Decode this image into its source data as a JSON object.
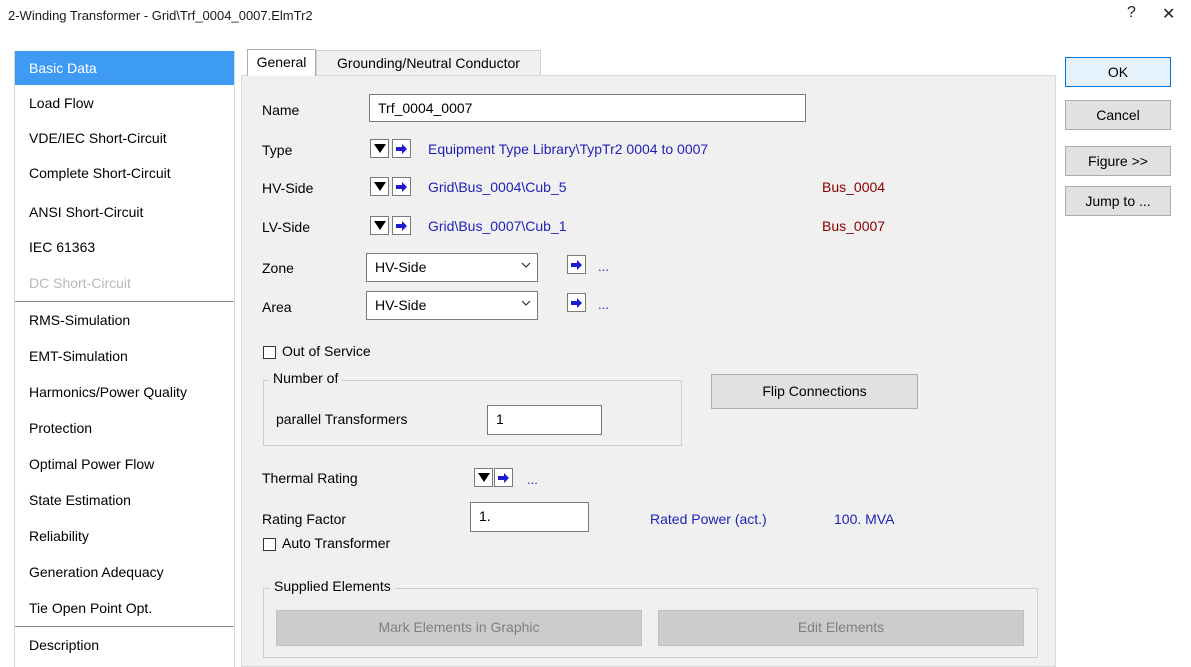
{
  "window": {
    "title": "2-Winding Transformer - Grid\\Trf_0004_0007.ElmTr2",
    "help_glyph": "?",
    "close_glyph": "✕"
  },
  "nav": {
    "items": [
      {
        "label": "Basic Data"
      },
      {
        "label": "Load Flow"
      },
      {
        "label": "VDE/IEC Short-Circuit"
      },
      {
        "label": "Complete Short-Circuit"
      },
      {
        "label": "ANSI Short-Circuit"
      },
      {
        "label": "IEC 61363"
      },
      {
        "label": "DC Short-Circuit"
      },
      {
        "label": "RMS-Simulation"
      },
      {
        "label": "EMT-Simulation"
      },
      {
        "label": "Harmonics/Power Quality"
      },
      {
        "label": "Protection"
      },
      {
        "label": "Optimal Power Flow"
      },
      {
        "label": "State Estimation"
      },
      {
        "label": "Reliability"
      },
      {
        "label": "Generation Adequacy"
      },
      {
        "label": "Tie Open Point Opt."
      },
      {
        "label": "Description"
      }
    ],
    "selected": "Basic Data",
    "disabled": [
      "DC Short-Circuit"
    ]
  },
  "tabs": {
    "general": "General",
    "grounding": "Grounding/Neutral Conductor"
  },
  "form": {
    "name_label": "Name",
    "name_value": "Trf_0004_0007",
    "type_label": "Type",
    "type_link": "Equipment Type Library\\TypTr2 0004 to 0007",
    "hv_label": "HV-Side",
    "hv_link": "Grid\\Bus_0004\\Cub_5",
    "hv_bus": "Bus_0004",
    "lv_label": "LV-Side",
    "lv_link": "Grid\\Bus_0007\\Cub_1",
    "lv_bus": "Bus_0007",
    "zone_label": "Zone",
    "zone_value": "HV-Side",
    "area_label": "Area",
    "area_value": "HV-Side",
    "ellipsis": "...",
    "out_of_service_label": "Out of Service",
    "out_of_service_checked": false,
    "number_of_group": "Number of",
    "parallel_label": "parallel Transformers",
    "parallel_value": "1",
    "flip_button": "Flip Connections",
    "thermal_label": "Thermal Rating",
    "rating_factor_label": "Rating Factor",
    "rating_factor_value": "1.",
    "rated_power_label": "Rated Power (act.)",
    "rated_power_value": "100. MVA",
    "auto_transformer_label": "Auto Transformer",
    "auto_transformer_checked": false,
    "supplied_group": "Supplied Elements",
    "mark_button": "Mark Elements in Graphic",
    "edit_button": "Edit Elements"
  },
  "actions": {
    "ok": "OK",
    "cancel": "Cancel",
    "figure": "Figure >>",
    "jump": "Jump to ..."
  },
  "colors": {
    "selection": "#3d9bf4",
    "link": "#1f1fb4",
    "bus": "#8b0000",
    "panel": "#f0f0f0"
  }
}
